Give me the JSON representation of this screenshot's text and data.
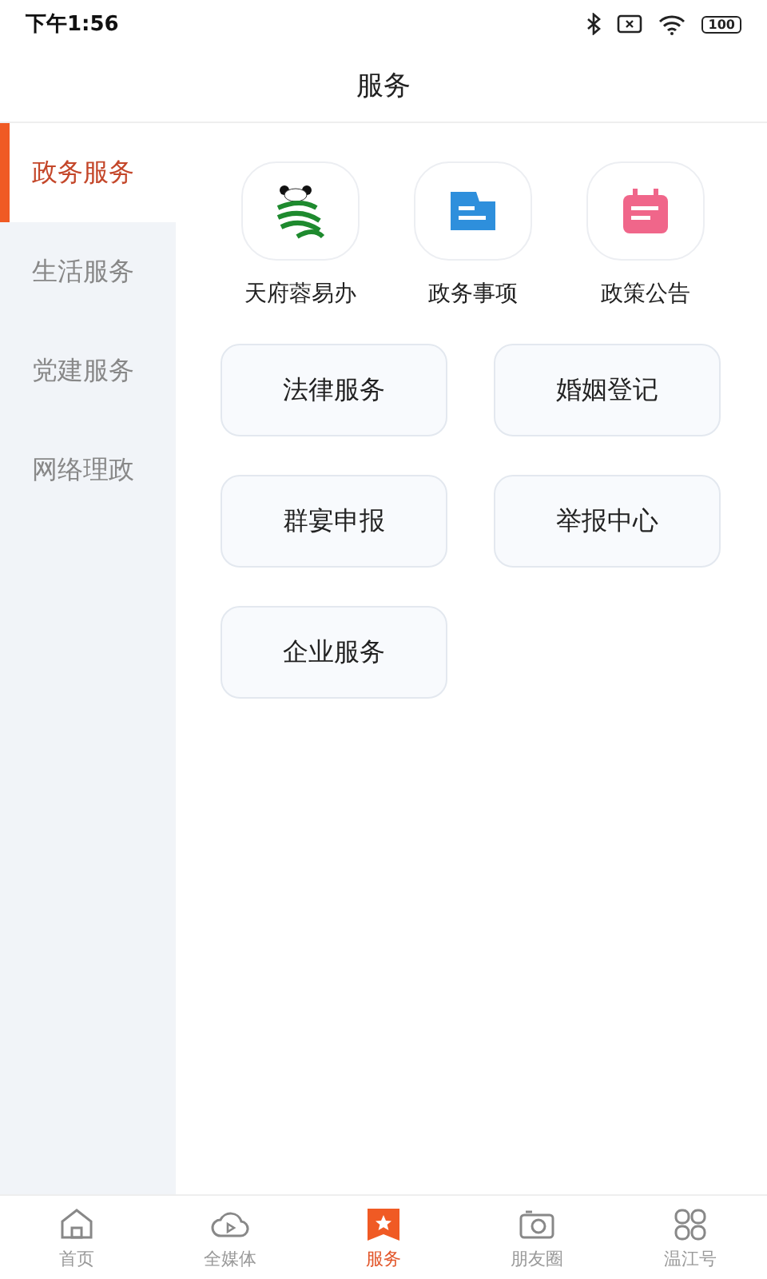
{
  "status_bar": {
    "time": "下午1:56",
    "battery": "100"
  },
  "header": {
    "title": "服务"
  },
  "sidebar": {
    "items": [
      {
        "label": "政务服务",
        "selected": true
      },
      {
        "label": "生活服务",
        "selected": false
      },
      {
        "label": "党建服务",
        "selected": false
      },
      {
        "label": "网络理政",
        "selected": false
      }
    ]
  },
  "apps": [
    {
      "label": "天府蓉易办",
      "kind": "panda"
    },
    {
      "label": "政务事项",
      "kind": "folder"
    },
    {
      "label": "政策公告",
      "kind": "calendar"
    }
  ],
  "services": [
    "法律服务",
    "婚姻登记",
    "群宴申报",
    "举报中心",
    "企业服务"
  ],
  "tab_bar": [
    {
      "label": "首页",
      "kind": "home",
      "selected": false
    },
    {
      "label": "全媒体",
      "kind": "cloud",
      "selected": false
    },
    {
      "label": "服务",
      "kind": "star",
      "selected": true
    },
    {
      "label": "朋友圈",
      "kind": "camera",
      "selected": false
    },
    {
      "label": "温江号",
      "kind": "grid",
      "selected": false
    }
  ]
}
